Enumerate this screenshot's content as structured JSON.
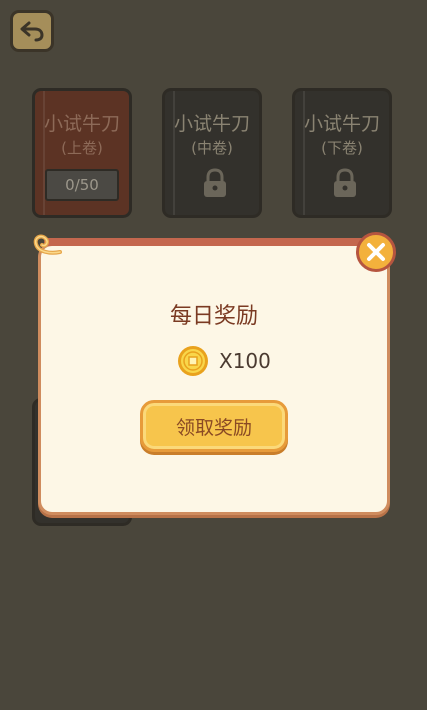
{
  "header": {
    "back_icon": "back-arrow-icon"
  },
  "levels": [
    {
      "title": "小试牛刀",
      "volume": "(上卷)",
      "progress": "0/50",
      "locked": false
    },
    {
      "title": "小试牛刀",
      "volume": "(中卷)",
      "locked": true
    },
    {
      "title": "小试牛刀",
      "volume": "(下卷)",
      "locked": true
    }
  ],
  "dialog": {
    "title": "每日奖励",
    "reward_icon": "coin-icon",
    "reward_amount": "X100",
    "claim_label": "领取奖励",
    "close_icon": "close-icon"
  },
  "colors": {
    "background": "#4a463b",
    "dialog_bg": "#fdf7e6",
    "dialog_border": "#cf8c5e",
    "accent_button": "#f7c54c",
    "title_text": "#7a3a22"
  }
}
